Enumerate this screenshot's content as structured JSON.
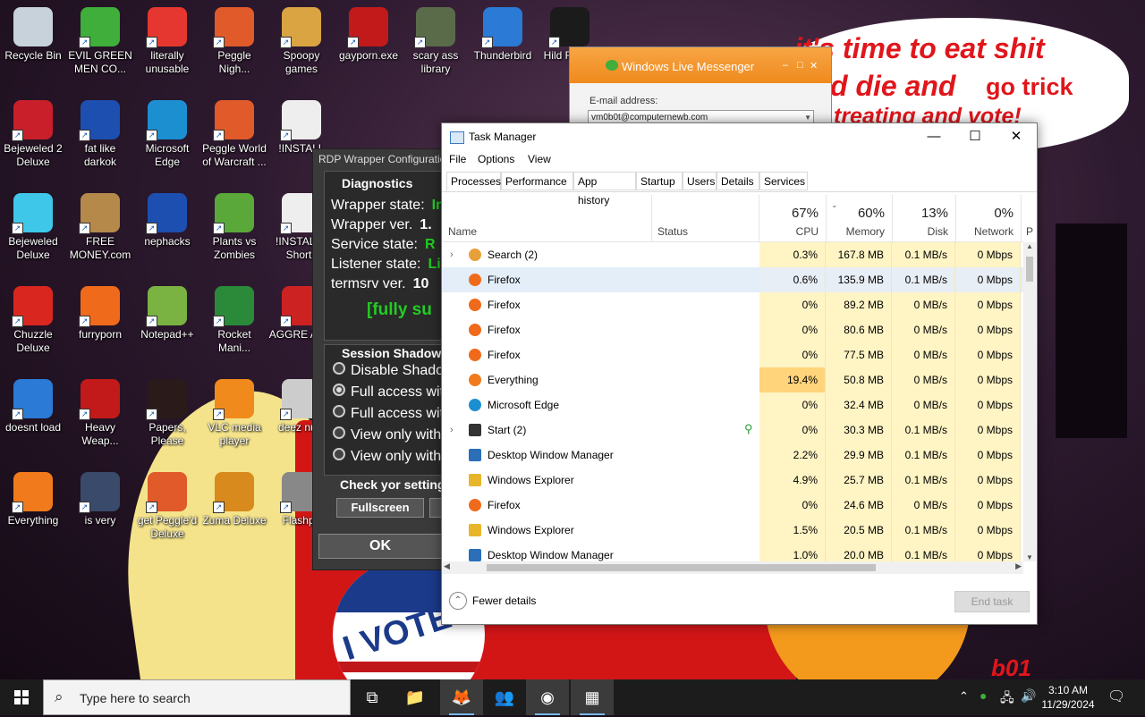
{
  "desktop": {
    "icons": [
      {
        "label": "Recycle Bin",
        "icon": "recycle-bin-icon",
        "color": "#c7d2da"
      },
      {
        "label": "EVIL GREEN MEN CO...",
        "icon": "messenger-men-icon",
        "color": "#3fae3a"
      },
      {
        "label": "literally unusable",
        "icon": "chrome-icon",
        "color": "#e5372f"
      },
      {
        "label": "Peggle Nigh...",
        "icon": "peggle-icon",
        "color": "#e05a2a"
      },
      {
        "label": "Spoopy games",
        "icon": "folder-icon",
        "color": "#d9a441"
      },
      {
        "label": "gayporn.exe",
        "icon": "flash-icon",
        "color": "#c21a1a"
      },
      {
        "label": "scary ass library",
        "icon": "library-icon",
        "color": "#5a6b4a"
      },
      {
        "label": "Thunderbird",
        "icon": "thunderbird-icon",
        "color": "#2a7ad6"
      },
      {
        "label": "Hild Ranso",
        "icon": "yashma-icon",
        "color": "#1b1b1b"
      },
      {
        "label": "Bejeweled 2 Deluxe",
        "icon": "bejeweled2-icon",
        "color": "#c81f2a"
      },
      {
        "label": "fat like darkok",
        "icon": "mpi-icon",
        "color": "#1d4fb0"
      },
      {
        "label": "Microsoft Edge",
        "icon": "edge-icon",
        "color": "#1c8fd1"
      },
      {
        "label": "Peggle World of Warcraft ...",
        "icon": "peggle-icon",
        "color": "#e05a2a"
      },
      {
        "label": "!INSTALL",
        "icon": "document-icon",
        "color": "#eeeeee"
      },
      {
        "label": "Bejeweled Deluxe",
        "icon": "diamond-icon",
        "color": "#3ec7e8"
      },
      {
        "label": "FREE MONEY.com",
        "icon": "money-bag-icon",
        "color": "#b5894a"
      },
      {
        "label": "nephacks",
        "icon": "mpi-icon",
        "color": "#1d4fb0"
      },
      {
        "label": "Plants vs Zombies",
        "icon": "plants-icon",
        "color": "#5aa83a"
      },
      {
        "label": "!INSTALL - Shortc",
        "icon": "document-icon",
        "color": "#eeeeee"
      },
      {
        "label": "Chuzzle Deluxe",
        "icon": "chuzzle-icon",
        "color": "#d9271f"
      },
      {
        "label": "furryporn",
        "icon": "firefox-icon",
        "color": "#f06a1c"
      },
      {
        "label": "Notepad++",
        "icon": "notepadpp-icon",
        "color": "#7ab342"
      },
      {
        "label": "Rocket Mani...",
        "icon": "rocket-icon",
        "color": "#2a8a3a"
      },
      {
        "label": "AGGRE AVIA",
        "icon": "aggre-icon",
        "color": "#c22"
      },
      {
        "label": "doesnt load",
        "icon": "thunderbird-icon",
        "color": "#2a7ad6"
      },
      {
        "label": "Heavy Weap...",
        "icon": "radiation-icon",
        "color": "#c21a1a"
      },
      {
        "label": "Papers, Please",
        "icon": "papers-icon",
        "color": "#2a1a1a"
      },
      {
        "label": "VLC media player",
        "icon": "vlc-icon",
        "color": "#f08a1c"
      },
      {
        "label": "deez nuts",
        "icon": "copy-icon",
        "color": "#cccccc"
      },
      {
        "label": "Everything",
        "icon": "everything-icon",
        "color": "#f07a1c"
      },
      {
        "label": "is very",
        "icon": "mpi-shield-icon",
        "color": "#3a4a6a"
      },
      {
        "label": "get Peggle'd Deluxe",
        "icon": "peggle-icon",
        "color": "#e05a2a"
      },
      {
        "label": "Zuma Deluxe",
        "icon": "zuma-icon",
        "color": "#d98a1c"
      },
      {
        "label": "Flashpo",
        "icon": "flashpoint-icon",
        "color": "#888888"
      }
    ],
    "bubble": {
      "line1": "it's time to eat shit",
      "line2": "d die and",
      "line2b": "go trick",
      "line3": "treating and vote!"
    },
    "sticker": {
      "vote": "I VOTE"
    },
    "corner_tag": "b01"
  },
  "messenger": {
    "title": "Windows Live Messenger",
    "email_label": "E-mail address:",
    "email_value": "vm0b0t@computernewb.com"
  },
  "rdp": {
    "title": "RDP Wrapper Configuration",
    "diagnostics": "Diagnostics",
    "rows": [
      {
        "label": "Wrapper state:",
        "value": "In",
        "color": "#22cc22"
      },
      {
        "label": "Wrapper ver.",
        "value": "1.",
        "color": "#ffffff"
      },
      {
        "label": "Service state:",
        "value": "R",
        "color": "#22cc22"
      },
      {
        "label": "Listener state:",
        "value": "Li",
        "color": "#22cc22"
      },
      {
        "label": "termsrv ver.",
        "value": "10",
        "color": "#ffffff"
      }
    ],
    "support": "[fully su",
    "session_head": "Session Shadowin",
    "radios": [
      "Disable Shadow",
      "Full access with",
      "Full access with",
      "View only with",
      "View only with"
    ],
    "radio_selected": 1,
    "check_head": "Check yor setting",
    "fullscreen": "Fullscreen",
    "ok": "OK"
  },
  "taskmanager": {
    "title": "Task Manager",
    "menu": [
      "File",
      "Options",
      "View"
    ],
    "tabs": [
      "Processes",
      "Performance",
      "App history",
      "Startup",
      "Users",
      "Details",
      "Services"
    ],
    "active_tab": "Processes",
    "columns": {
      "name": "Name",
      "status": "Status",
      "cpu": {
        "pct": "67%",
        "label": "CPU"
      },
      "memory": {
        "pct": "60%",
        "label": "Memory"
      },
      "disk": {
        "pct": "13%",
        "label": "Disk"
      },
      "network": {
        "pct": "0%",
        "label": "Network"
      },
      "extra": "P"
    },
    "rows": [
      {
        "name": "Search (2)",
        "icon": "search-app-icon",
        "expand": true,
        "cpu": "0.3%",
        "mem": "167.8 MB",
        "disk": "0.1 MB/s",
        "net": "0 Mbps"
      },
      {
        "name": "Firefox",
        "icon": "firefox-icon",
        "selected": true,
        "cpu": "0.6%",
        "mem": "135.9 MB",
        "disk": "0.1 MB/s",
        "net": "0 Mbps"
      },
      {
        "name": "Firefox",
        "icon": "firefox-icon",
        "cpu": "0%",
        "mem": "89.2 MB",
        "disk": "0 MB/s",
        "net": "0 Mbps"
      },
      {
        "name": "Firefox",
        "icon": "firefox-icon",
        "cpu": "0%",
        "mem": "80.6 MB",
        "disk": "0 MB/s",
        "net": "0 Mbps"
      },
      {
        "name": "Firefox",
        "icon": "firefox-icon",
        "cpu": "0%",
        "mem": "77.5 MB",
        "disk": "0 MB/s",
        "net": "0 Mbps"
      },
      {
        "name": "Everything",
        "icon": "everything-icon",
        "cpu": "19.4%",
        "cpuHot": true,
        "mem": "50.8 MB",
        "disk": "0 MB/s",
        "net": "0 Mbps"
      },
      {
        "name": "Microsoft Edge",
        "icon": "edge-icon",
        "cpu": "0%",
        "mem": "32.4 MB",
        "disk": "0 MB/s",
        "net": "0 Mbps"
      },
      {
        "name": "Start (2)",
        "icon": "start-app-icon",
        "expand": true,
        "leaf": true,
        "cpu": "0%",
        "mem": "30.3 MB",
        "disk": "0.1 MB/s",
        "net": "0 Mbps"
      },
      {
        "name": "Desktop Window Manager",
        "icon": "dwm-icon",
        "cpu": "2.2%",
        "mem": "29.9 MB",
        "disk": "0.1 MB/s",
        "net": "0 Mbps"
      },
      {
        "name": "Windows Explorer",
        "icon": "explorer-icon",
        "cpu": "4.9%",
        "mem": "25.7 MB",
        "disk": "0.1 MB/s",
        "net": "0 Mbps"
      },
      {
        "name": "Firefox",
        "icon": "firefox-icon",
        "cpu": "0%",
        "mem": "24.6 MB",
        "disk": "0 MB/s",
        "net": "0 Mbps"
      },
      {
        "name": "Windows Explorer",
        "icon": "explorer-icon",
        "cpu": "1.5%",
        "mem": "20.5 MB",
        "disk": "0.1 MB/s",
        "net": "0 Mbps"
      },
      {
        "name": "Desktop Window Manager",
        "icon": "dwm-icon",
        "cpu": "1.0%",
        "mem": "20.0 MB",
        "disk": "0.1 MB/s",
        "net": "0 Mbps"
      }
    ],
    "fewer_details": "Fewer details",
    "end_task": "End task"
  },
  "taskbar": {
    "search_placeholder": "Type here to search",
    "apps": [
      {
        "icon": "task-view-icon",
        "glyph": "⧉",
        "active": false
      },
      {
        "icon": "file-explorer-icon",
        "glyph": "📁",
        "active": false
      },
      {
        "icon": "firefox-icon",
        "glyph": "🦊",
        "active": true
      },
      {
        "icon": "messenger-icon",
        "glyph": "👥",
        "active": false
      },
      {
        "icon": "app-icon",
        "glyph": "◉",
        "active": true
      },
      {
        "icon": "task-manager-icon",
        "glyph": "▦",
        "active": true
      }
    ],
    "time": "3:10 AM",
    "date": "11/29/2024"
  },
  "colors": {
    "cpu_heat_light": "#fff4c4",
    "cpu_heat_hot": "#ffd47a",
    "selection": "#e3eef9",
    "messenger_orange": "#f29630"
  }
}
